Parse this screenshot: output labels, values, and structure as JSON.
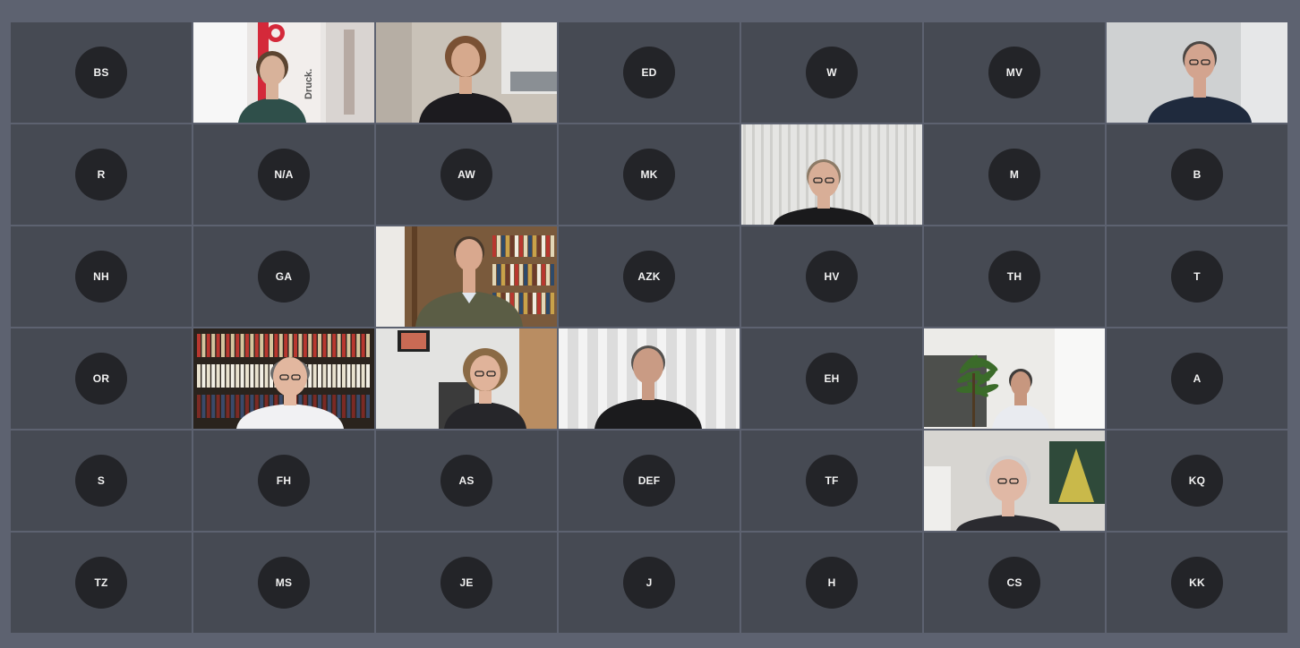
{
  "meeting": {
    "view": "gallery",
    "participants": [
      {
        "initials": "BS",
        "video": false
      },
      {
        "initials": "",
        "video": true,
        "scene": "woman-sign",
        "active": true,
        "sign_text": "Druck."
      },
      {
        "initials": "",
        "video": true,
        "scene": "woman-office"
      },
      {
        "initials": "ED",
        "video": false
      },
      {
        "initials": "W",
        "video": false
      },
      {
        "initials": "MV",
        "video": false
      },
      {
        "initials": "",
        "video": true,
        "scene": "man-beard"
      },
      {
        "initials": "R",
        "video": false
      },
      {
        "initials": "N/A",
        "video": false
      },
      {
        "initials": "AW",
        "video": false
      },
      {
        "initials": "MK",
        "video": false
      },
      {
        "initials": "",
        "video": true,
        "scene": "man-blinds"
      },
      {
        "initials": "M",
        "video": false
      },
      {
        "initials": "B",
        "video": false
      },
      {
        "initials": "NH",
        "video": false
      },
      {
        "initials": "GA",
        "video": false
      },
      {
        "initials": "",
        "video": true,
        "scene": "man-bookshelf"
      },
      {
        "initials": "AZK",
        "video": false
      },
      {
        "initials": "HV",
        "video": false
      },
      {
        "initials": "TH",
        "video": false
      },
      {
        "initials": "T",
        "video": false
      },
      {
        "initials": "OR",
        "video": false
      },
      {
        "initials": "",
        "video": true,
        "scene": "man-library"
      },
      {
        "initials": "",
        "video": true,
        "scene": "woman-painting"
      },
      {
        "initials": "",
        "video": true,
        "scene": "man-curtain"
      },
      {
        "initials": "EH",
        "video": false
      },
      {
        "initials": "",
        "video": true,
        "scene": "man-plant"
      },
      {
        "initials": "A",
        "video": false
      },
      {
        "initials": "S",
        "video": false
      },
      {
        "initials": "FH",
        "video": false
      },
      {
        "initials": "AS",
        "video": false
      },
      {
        "initials": "DEF",
        "video": false
      },
      {
        "initials": "TF",
        "video": false
      },
      {
        "initials": "",
        "video": true,
        "scene": "man-glasses-art"
      },
      {
        "initials": "KQ",
        "video": false
      },
      {
        "initials": "TZ",
        "video": false
      },
      {
        "initials": "MS",
        "video": false
      },
      {
        "initials": "JE",
        "video": false
      },
      {
        "initials": "J",
        "video": false
      },
      {
        "initials": "H",
        "video": false
      },
      {
        "initials": "CS",
        "video": false
      },
      {
        "initials": "KK",
        "video": false
      }
    ]
  },
  "colors": {
    "window_bg": "#5d6270",
    "tile_bg": "#464a53",
    "avatar_bg": "#232428",
    "avatar_text": "#f2f2f2",
    "active_border": "#ffffff",
    "sign_red": "#d4293a"
  }
}
